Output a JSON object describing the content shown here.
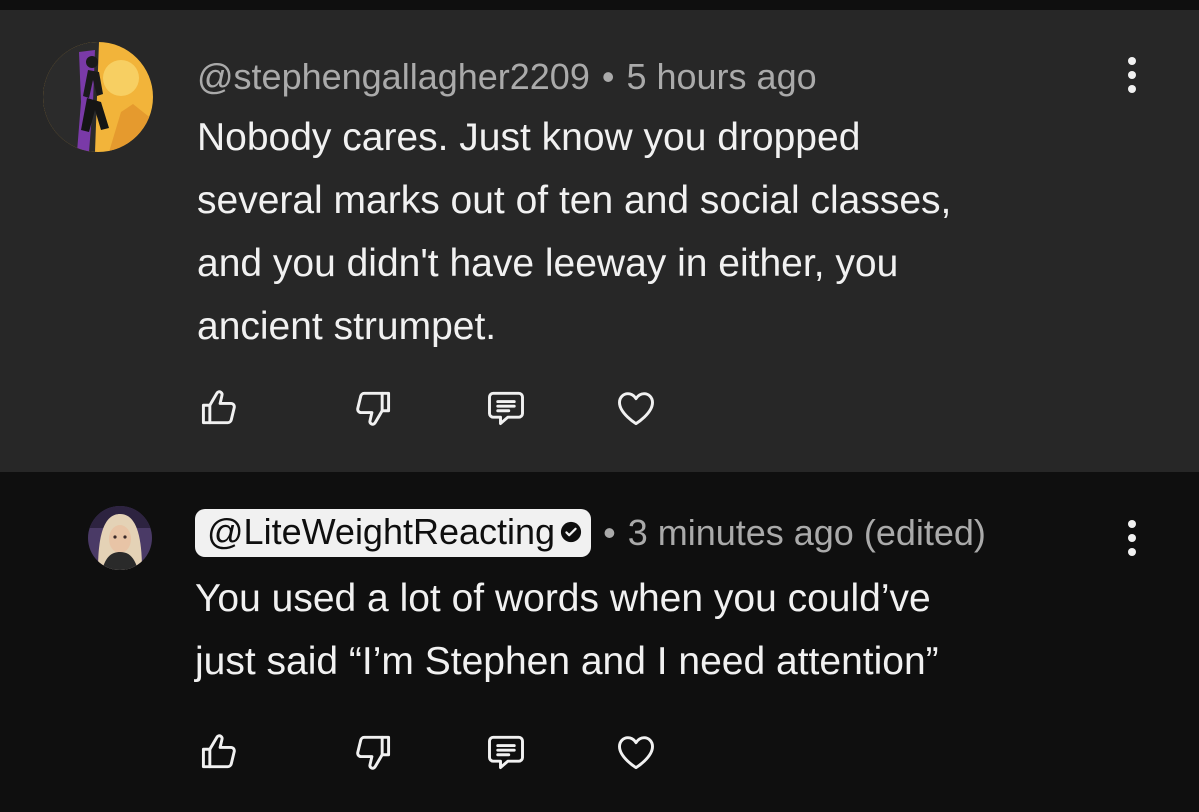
{
  "comments": [
    {
      "handle": "@stephengallagher2209",
      "separator": "•",
      "time": "5 hours ago",
      "lines": [
        "Nobody cares. Just know you dropped",
        "several marks out of ten and social classes,",
        "and you didn't have leeway in either, you",
        "ancient strumpet."
      ]
    },
    {
      "handle": "@LiteWeightReacting",
      "separator": "•",
      "time": "3 minutes ago (edited)",
      "lines": [
        "You used a lot of words when you could’ve",
        "just said “I’m Stephen and I need attention”"
      ]
    }
  ],
  "icons": {
    "like": "thumbs-up-icon",
    "dislike": "thumbs-down-icon",
    "reply": "reply-comment-icon",
    "heart": "heart-icon",
    "menu": "more-vertical-icon",
    "verified": "verified-check-icon"
  },
  "colors": {
    "background": "#0f0f0f",
    "highlight_background": "#272727",
    "primary_text": "#f1f1f1",
    "secondary_text": "#aaaaaa",
    "handle_pill": "#f1f1f1"
  }
}
